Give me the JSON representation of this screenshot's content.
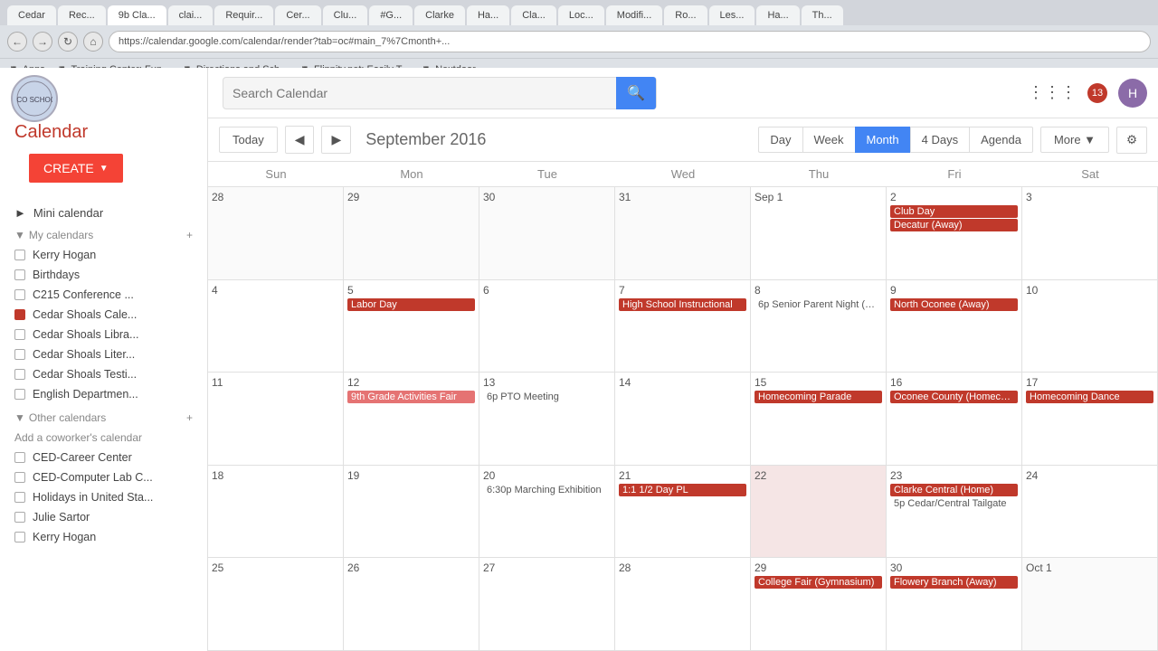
{
  "browser": {
    "tabs": [
      {
        "label": "Cedar",
        "active": false
      },
      {
        "label": "Rec...",
        "active": false
      },
      {
        "label": "9b Cla...",
        "active": true
      },
      {
        "label": "clai...",
        "active": false
      },
      {
        "label": "Requir...",
        "active": false
      },
      {
        "label": "Cer...",
        "active": false
      },
      {
        "label": "Clu...",
        "active": false
      },
      {
        "label": "#G...",
        "active": false
      },
      {
        "label": "Clarke",
        "active": false
      },
      {
        "label": "Ha...",
        "active": false
      },
      {
        "label": "Cla...",
        "active": false
      },
      {
        "label": "Loc...",
        "active": false
      },
      {
        "label": "Modifi...",
        "active": false
      },
      {
        "label": "Ro...",
        "active": false
      },
      {
        "label": "Les...",
        "active": false
      },
      {
        "label": "Ha...",
        "active": false
      },
      {
        "label": "Th...",
        "active": false
      }
    ],
    "url": "https://calendar.google.com/calendar/render?tab=oc#main_7%7Cmonth+...",
    "bookmarks": [
      "Apps",
      "Training Center: Fun...",
      "Directions and Sch...",
      "Flippity.net: Easily T...",
      "Nextdoor"
    ]
  },
  "header": {
    "search_placeholder": "Search Calendar",
    "notification_count": "13"
  },
  "sidebar": {
    "title": "Calendar",
    "create_label": "CREATE",
    "mini_calendar_label": "Mini calendar",
    "my_calendars_label": "My calendars",
    "other_calendars_label": "Other calendars",
    "calendars": [
      {
        "name": "Kerry Hogan",
        "colored": false
      },
      {
        "name": "Birthdays",
        "colored": false
      },
      {
        "name": "C215 Conference ...",
        "colored": false
      },
      {
        "name": "Cedar Shoals Cale...",
        "colored": true
      },
      {
        "name": "Cedar Shoals Libra...",
        "colored": false
      },
      {
        "name": "Cedar Shoals Liter...",
        "colored": false
      },
      {
        "name": "Cedar Shoals Testi...",
        "colored": false
      },
      {
        "name": "English Departmen...",
        "colored": false
      }
    ],
    "other_calendars": [
      {
        "name": "CED-Career Center",
        "colored": false
      },
      {
        "name": "CED-Computer Lab C...",
        "colored": false
      },
      {
        "name": "Holidays in United Sta...",
        "colored": false
      },
      {
        "name": "Julie Sartor",
        "colored": false
      },
      {
        "name": "Kerry Hogan",
        "colored": false
      }
    ],
    "add_coworker": "Add a coworker's calendar"
  },
  "toolbar": {
    "today": "Today",
    "month_title": "September 2016",
    "views": [
      "Day",
      "Week",
      "Month",
      "4 Days",
      "Agenda"
    ],
    "active_view": "Month",
    "more": "More",
    "settings_icon": "⚙"
  },
  "calendar": {
    "day_headers": [
      "Sun",
      "Mon",
      "Tue",
      "Wed",
      "Thu",
      "Fri",
      "Sat"
    ],
    "weeks": [
      {
        "days": [
          {
            "number": "28",
            "other": true,
            "events": []
          },
          {
            "number": "29",
            "other": true,
            "events": []
          },
          {
            "number": "30",
            "other": true,
            "events": []
          },
          {
            "number": "31",
            "other": true,
            "events": []
          },
          {
            "number": "Sep 1",
            "other": false,
            "events": []
          },
          {
            "number": "2",
            "other": false,
            "events": [
              {
                "text": "Club Day",
                "style": "red-bg"
              },
              {
                "text": "Decatur (Away)",
                "style": "red-bg"
              }
            ]
          },
          {
            "number": "3",
            "other": false,
            "events": []
          }
        ]
      },
      {
        "days": [
          {
            "number": "4",
            "other": false,
            "events": []
          },
          {
            "number": "5",
            "other": false,
            "events": [
              {
                "text": "Labor Day",
                "style": "red-bg"
              }
            ]
          },
          {
            "number": "6",
            "other": false,
            "events": []
          },
          {
            "number": "7",
            "other": false,
            "events": [
              {
                "text": "High School Instructional",
                "style": "red-bg"
              }
            ]
          },
          {
            "number": "8",
            "other": false,
            "events": [
              {
                "text": "6p Senior Parent Night (The...",
                "style": "text-only"
              }
            ]
          },
          {
            "number": "9",
            "other": false,
            "events": [
              {
                "text": "North Oconee (Away)",
                "style": "red-bg"
              }
            ]
          },
          {
            "number": "10",
            "other": false,
            "events": []
          }
        ]
      },
      {
        "days": [
          {
            "number": "11",
            "other": false,
            "events": []
          },
          {
            "number": "12",
            "other": false,
            "events": [
              {
                "text": "9th Grade Activities Fair",
                "style": "pink-bg"
              }
            ]
          },
          {
            "number": "13",
            "other": false,
            "events": [
              {
                "text": "6p PTO Meeting",
                "style": "text-only"
              }
            ]
          },
          {
            "number": "14",
            "other": false,
            "events": []
          },
          {
            "number": "15",
            "other": false,
            "events": [
              {
                "text": "Homecoming Parade",
                "style": "red-bg"
              }
            ]
          },
          {
            "number": "16",
            "other": false,
            "events": [
              {
                "text": "Oconee County (Homecon...",
                "style": "red-bg"
              }
            ]
          },
          {
            "number": "17",
            "other": false,
            "events": [
              {
                "text": "Homecoming Dance",
                "style": "red-bg"
              }
            ]
          }
        ]
      },
      {
        "days": [
          {
            "number": "18",
            "other": false,
            "events": []
          },
          {
            "number": "19",
            "other": false,
            "events": []
          },
          {
            "number": "20",
            "other": false,
            "events": [
              {
                "text": "6:30p Marching Exhibition",
                "style": "text-only"
              }
            ]
          },
          {
            "number": "21",
            "other": false,
            "events": [
              {
                "text": "1:1 1/2 Day PL",
                "style": "half-day"
              }
            ]
          },
          {
            "number": "22",
            "other": false,
            "events": []
          },
          {
            "number": "23",
            "other": false,
            "events": [
              {
                "text": "Clarke Central (Home)",
                "style": "red-bg"
              },
              {
                "text": "5p Cedar/Central Tailgate",
                "style": "text-only"
              }
            ]
          },
          {
            "number": "24",
            "other": false,
            "events": []
          }
        ]
      },
      {
        "days": [
          {
            "number": "25",
            "other": false,
            "events": []
          },
          {
            "number": "26",
            "other": false,
            "events": []
          },
          {
            "number": "27",
            "other": false,
            "events": []
          },
          {
            "number": "28",
            "other": false,
            "events": []
          },
          {
            "number": "29",
            "other": false,
            "events": [
              {
                "text": "College Fair (Gymnasium)",
                "style": "red-bg"
              }
            ]
          },
          {
            "number": "30",
            "other": false,
            "events": [
              {
                "text": "Flowery Branch (Away)",
                "style": "red-bg"
              }
            ]
          },
          {
            "number": "Oct 1",
            "other": true,
            "events": []
          }
        ]
      }
    ]
  }
}
